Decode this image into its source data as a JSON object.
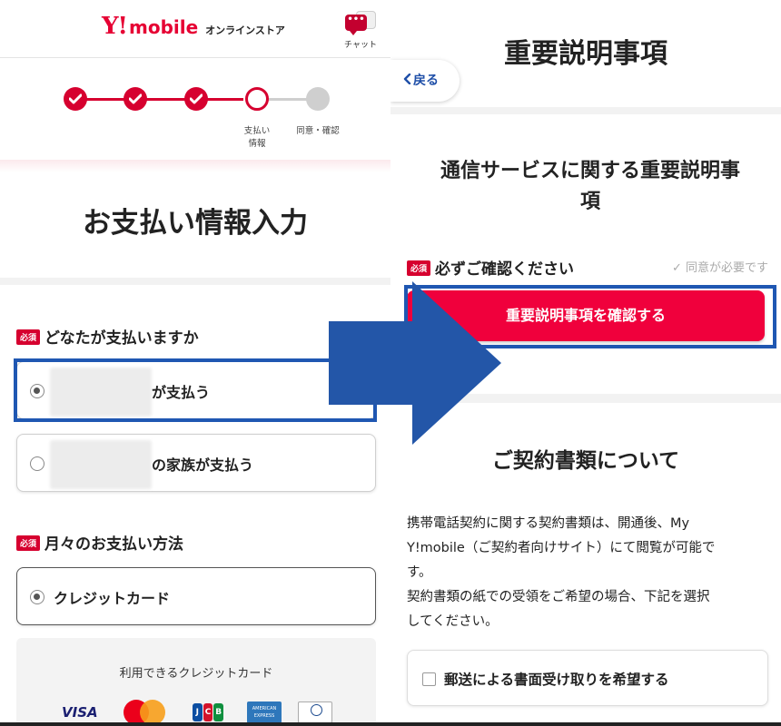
{
  "left": {
    "header": {
      "logo_y": "Y!",
      "logo_mobile": "mobile",
      "store_label": "オンラインストア",
      "chat_label": "チャット"
    },
    "steps": {
      "current_step": 4,
      "total_steps": 5,
      "labels": {
        "step4_line1": "支払い",
        "step4_line2": "情報",
        "step5": "同意・確認"
      }
    },
    "page_title": "お支払い情報入力",
    "required_badge": "必須",
    "payer_question": "どなたが支払いますか",
    "payer_options": [
      {
        "text": "が支払う",
        "selected": true
      },
      {
        "text": "の家族が支払う",
        "selected": false
      }
    ],
    "method_question": "月々のお支払い方法",
    "method_option": {
      "text": "クレジットカード",
      "selected": true
    },
    "cards_title": "利用できるクレジットカード",
    "cards": [
      "VISA",
      "Mastercard",
      "JCB",
      "American Express",
      "Diners Club"
    ]
  },
  "right": {
    "page_title": "重要説明事項",
    "back_label": "戻る",
    "service_title_line1": "通信サービスに関する重要説明事",
    "service_title_line2": "項",
    "confirm_title": "必ずご確認ください",
    "agree_note": "✓ 同意が必要です",
    "confirm_button": "重要説明事項を確認する",
    "docs_title": "ご契約書類について",
    "docs_body_line1": "携帯電話契約に関する契約書類は、開通後、My",
    "docs_body_line2": "Y!mobile（ご契約者向けサイト）にて閲覧が可能で",
    "docs_body_line3": "す。",
    "docs_body_line4": "契約書類の紙での受領をご希望の場合、下記を選択",
    "docs_body_line5": "してください。",
    "mail_option": "郵送による書面受け取りを希望する"
  },
  "colors": {
    "brand_red": "#e60033",
    "button_red": "#f0003c",
    "highlight_blue": "#1f57b2",
    "arrow_blue": "#2356a8"
  }
}
